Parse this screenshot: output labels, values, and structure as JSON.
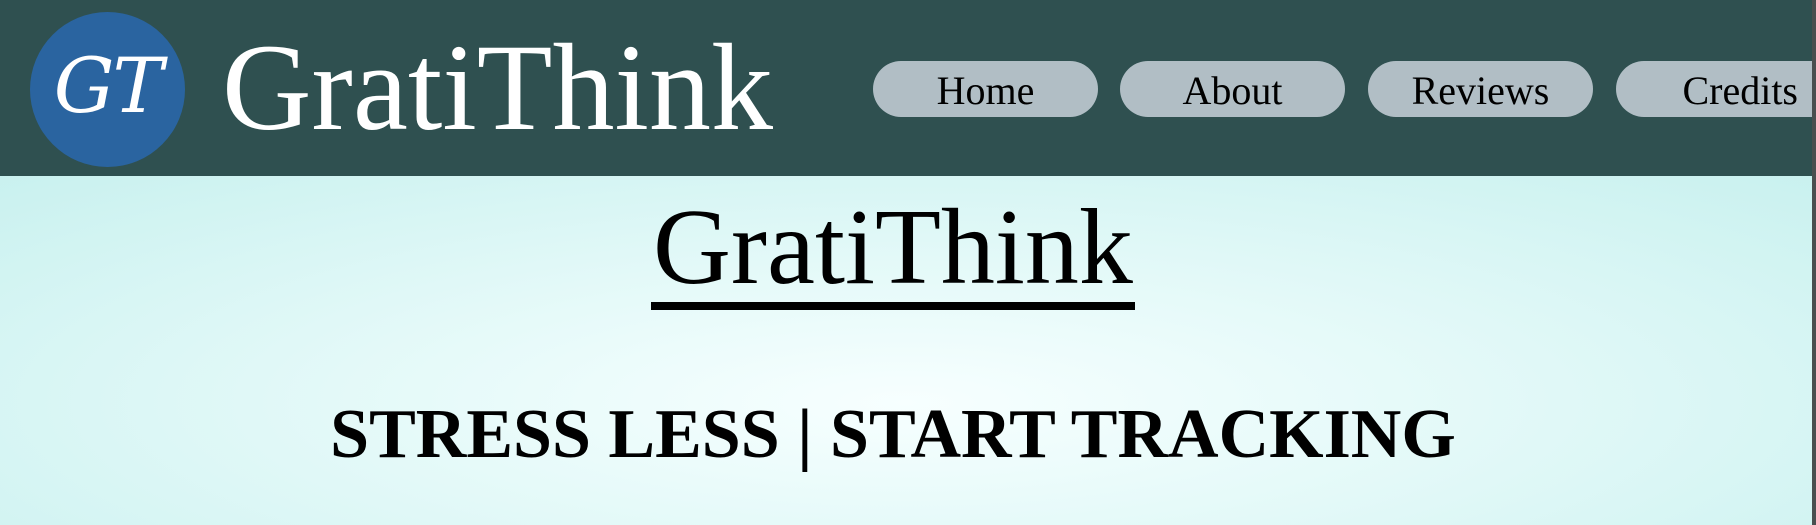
{
  "header": {
    "logo_text": "GT",
    "brand_name": "GratiThink",
    "nav": [
      {
        "label": "Home"
      },
      {
        "label": "About"
      },
      {
        "label": "Reviews"
      },
      {
        "label": "Credits"
      }
    ]
  },
  "hero": {
    "title": "GratiThink",
    "tagline": "STRESS LESS | START TRACKING"
  },
  "colors": {
    "header_bg": "#2f5050",
    "logo_bg": "#2a64a0",
    "nav_button_bg": "#b1bec5",
    "hero_bg": "#d6f6f4"
  }
}
